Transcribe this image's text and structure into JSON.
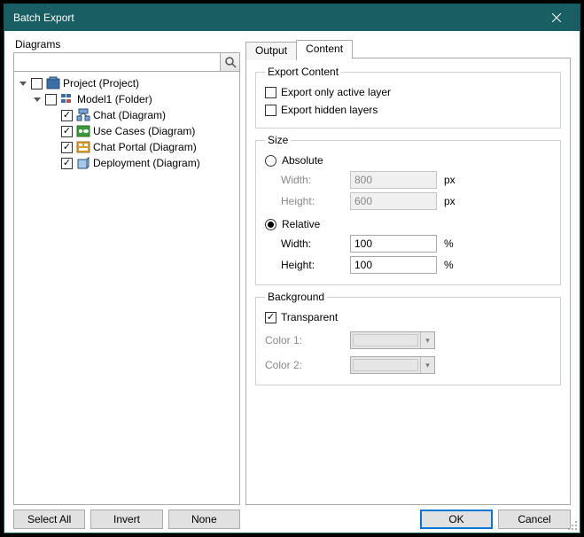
{
  "window": {
    "title": "Batch Export"
  },
  "left": {
    "label": "Diagrams",
    "search_placeholder": "",
    "tree": {
      "root": {
        "label": "Project (Project)",
        "checked": false
      },
      "child1": {
        "label": "Model1 (Folder)",
        "checked": false
      },
      "leaves": [
        {
          "label": "Chat (Diagram)",
          "checked": true,
          "icon": "class"
        },
        {
          "label": "Use Cases (Diagram)",
          "checked": true,
          "icon": "usecase"
        },
        {
          "label": "Chat Portal (Diagram)",
          "checked": true,
          "icon": "portal"
        },
        {
          "label": "Deployment (Diagram)",
          "checked": true,
          "icon": "deploy"
        }
      ]
    },
    "buttons": {
      "select_all": "Select All",
      "invert": "Invert",
      "none": "None"
    }
  },
  "tabs": {
    "output": "Output",
    "content": "Content"
  },
  "export_content": {
    "legend": "Export Content",
    "only_active_layer": {
      "label": "Export only active layer",
      "checked": false
    },
    "hidden_layers": {
      "label": "Export hidden layers",
      "checked": false
    }
  },
  "size": {
    "legend": "Size",
    "absolute": {
      "label": "Absolute",
      "selected": false
    },
    "relative": {
      "label": "Relative",
      "selected": true
    },
    "width_label": "Width:",
    "height_label": "Height:",
    "abs_width": "800",
    "abs_height": "600",
    "abs_unit": "px",
    "rel_width": "100",
    "rel_height": "100",
    "rel_unit": "%"
  },
  "background": {
    "legend": "Background",
    "transparent": {
      "label": "Transparent",
      "checked": true
    },
    "color1_label": "Color 1:",
    "color2_label": "Color 2:"
  },
  "dialog_buttons": {
    "ok": "OK",
    "cancel": "Cancel"
  }
}
